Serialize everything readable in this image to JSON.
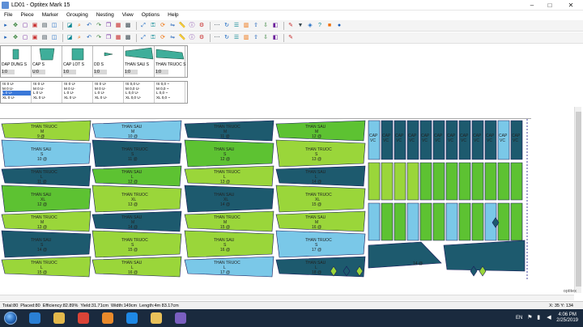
{
  "window": {
    "title": "LD01 - Optitex Mark 15",
    "minimize": "–",
    "maximize": "□",
    "close": "✕"
  },
  "menu": [
    "File",
    "Piece",
    "Marker",
    "Grouping",
    "Nesting",
    "View",
    "Options",
    "Help"
  ],
  "toolbar1_icons": [
    "pointer-icon",
    "move-icon",
    "new-icon",
    "open-icon",
    "save-icon",
    "print-icon",
    "print-preview-icon",
    "zoom-icon",
    "undo-icon",
    "redo-icon",
    "copy-icon",
    "paste-icon",
    "grid-icon",
    "fit-icon",
    "lock-icon",
    "rotate-icon",
    "flip-icon",
    "measure-icon",
    "info-icon",
    "settings-icon",
    "dots-icon",
    "refresh-icon",
    "layers-icon",
    "arrange-icon",
    "export-icon",
    "import-icon",
    "color-icon",
    "tool-icon",
    "filter-icon",
    "pin-icon",
    "help-icon",
    "stop-icon",
    "record-icon"
  ],
  "toolbar2_icons": [
    "select-icon",
    "move-piece-icon",
    "rotate-piece-icon",
    "flip-piece-icon",
    "mirror-icon",
    "align-icon",
    "group-icon",
    "ungroup-icon",
    "nest-icon",
    "auto-nest-icon",
    "snap-icon",
    "overlap-icon",
    "buffer-icon",
    "gap-icon",
    "table-icon",
    "chart-icon",
    "zoom-in-icon",
    "zoom-out-icon",
    "zoom-all-icon",
    "refresh-view-icon",
    "cancel-icon",
    "pattern-icon",
    "color-pieces-icon",
    "export-marker-icon",
    "report-icon",
    "cut-icon",
    "plot-icon",
    "calc-icon"
  ],
  "pieces": [
    {
      "name": "DAP DUNG S",
      "count": "1:0",
      "color": "#3fae9a"
    },
    {
      "name": "CAP S",
      "count": "U:0",
      "color": "#3fae9a"
    },
    {
      "name": "CAP LOT S",
      "count": "1:0",
      "color": "#3fae9a"
    },
    {
      "name": "DD S",
      "count": "1:0",
      "color": "#3fae9a"
    },
    {
      "name": "THAN SAU S",
      "count": "1:0",
      "color": "#3fae9a"
    },
    {
      "name": "THAN TRUOC S",
      "count": "1:0",
      "color": "#3fae9a"
    }
  ],
  "sizes": [
    [
      "!S  0  U-",
      "M  0  U-",
      "L  0  U-",
      "XL 0  U-"
    ],
    [
      "!S  0  U-",
      "M  0  U-",
      "L  0  U-",
      "XL 0  U-"
    ],
    [
      "!S  0  U-",
      "M  0  U-",
      "L  0  U-",
      "XL 0  U-"
    ],
    [
      "!S  0  U-",
      "M  0  U-",
      "L  0  U-",
      "XL 0  U-"
    ],
    [
      "!S  0,0 U-",
      "M  0,0 U-",
      "L  0,0 U-",
      "XL 0,0 U-"
    ],
    [
      "!S  0,0 ~",
      "M  0,0 ~",
      "L  0,0 ~",
      "XL 0,0 ~"
    ]
  ],
  "marker_labels": [
    "THAN TRUOC",
    "THAN SAU",
    "THAN TRUOC",
    "THAN SAU",
    "THAN TRUOC",
    "THAN SAU",
    "CAP VC",
    "DD",
    "M",
    "S",
    "L",
    "XL",
    "9 @",
    "10 @",
    "11 @",
    "12 @",
    "13 @",
    "14 @",
    "15 @",
    "16 @",
    "17 @",
    "18 @"
  ],
  "status": {
    "total": "Total:80",
    "placed": "Placed:80",
    "efficiency": "Efficiency:82.89%",
    "yield": "Yield:31.71cm",
    "width": "Width:149cm",
    "length": "Length:4m 83.17cm",
    "coords": "X: 35    Y: 134"
  },
  "brand": "optitex",
  "taskbar": {
    "language": "EN",
    "time": "4:06 PM",
    "date": "2/25/2019",
    "apps": [
      {
        "name": "ie-icon",
        "color": "#2a7fd4"
      },
      {
        "name": "explorer-icon",
        "color": "#e3b94b"
      },
      {
        "name": "chrome-icon",
        "color": "#db4437"
      },
      {
        "name": "media-icon",
        "color": "#e98a2b"
      },
      {
        "name": "zalo-icon",
        "color": "#1e88e5"
      },
      {
        "name": "folder-icon",
        "color": "#e8c15a"
      },
      {
        "name": "optitex-icon",
        "color": "#7a5fc0"
      }
    ]
  },
  "colors": {
    "light_green": "#9ad63a",
    "green": "#5dc232",
    "dark_teal": "#1d5a6e",
    "light_blue": "#7ac8e8",
    "outline": "#1a1a5a"
  }
}
